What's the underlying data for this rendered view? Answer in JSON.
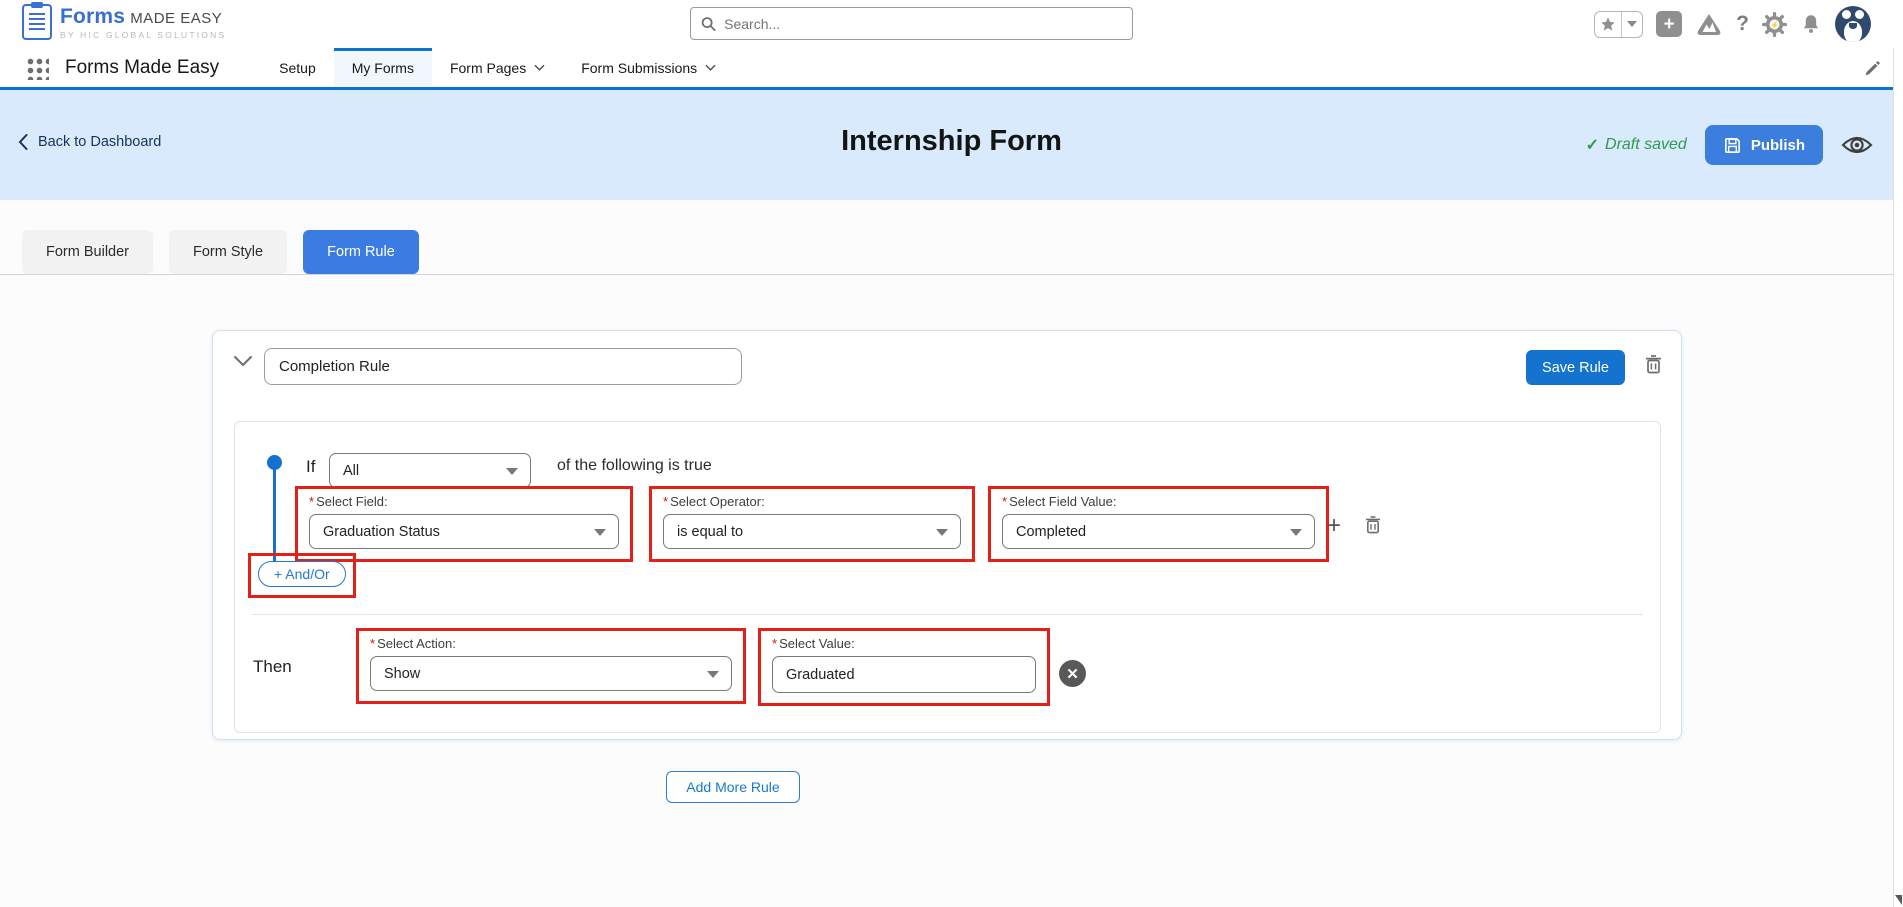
{
  "utility_bar": {
    "logo": {
      "brand": "Forms",
      "brand_suffix": "MADE EASY",
      "tagline": "BY HIC GLOBAL SOLUTIONS"
    },
    "search_placeholder": "Search...",
    "icon_names": [
      "favorites-star-icon",
      "favorites-dropdown-icon",
      "add-icon",
      "trailhead-icon",
      "help-icon",
      "setup-gear-icon",
      "notifications-bell-icon",
      "user-avatar"
    ],
    "help_glyph": "?",
    "plus_glyph": "+"
  },
  "nav": {
    "app_name": "Forms Made Easy",
    "tabs": [
      {
        "label": "Setup",
        "active": false,
        "has_dropdown": false
      },
      {
        "label": "My Forms",
        "active": true,
        "has_dropdown": false
      },
      {
        "label": "Form Pages",
        "active": false,
        "has_dropdown": true
      },
      {
        "label": "Form Submissions",
        "active": false,
        "has_dropdown": true
      }
    ]
  },
  "header": {
    "back_label": "Back to Dashboard",
    "title": "Internship Form",
    "draft_check": "✓",
    "draft_status": "Draft saved",
    "publish_label": "Publish"
  },
  "builder_tabs": [
    {
      "label": "Form Builder",
      "active": false
    },
    {
      "label": "Form Style",
      "active": false
    },
    {
      "label": "Form Rule",
      "active": true
    }
  ],
  "rule": {
    "name": "Completion Rule",
    "save_label": "Save Rule",
    "required_marker": "*",
    "if_label": "If",
    "match_value": "All",
    "if_suffix": "of the following is true",
    "condition": {
      "field_label": "Select Field:",
      "field_value": "Graduation Status",
      "operator_label": "Select Operator:",
      "operator_value": "is equal to",
      "value_label": "Select Field Value:",
      "value_value": "Completed"
    },
    "and_or_label": "+ And/Or",
    "then_label": "Then",
    "action_label": "Select Action:",
    "action_value": "Show",
    "value_label": "Select Value:",
    "value_value": "Graduated",
    "remove_glyph": "✕"
  },
  "footer": {
    "add_rule_label": "Add More Rule"
  },
  "colors": {
    "accent_blue": "#0b74d1",
    "save_button_blue": "#1373cf",
    "publish_blue": "#3c7ede",
    "header_band_blue": "#d8eafc",
    "annotation_red": "#e32119",
    "draft_green": "#2e9b4e",
    "link_blue": "#2478cf"
  }
}
